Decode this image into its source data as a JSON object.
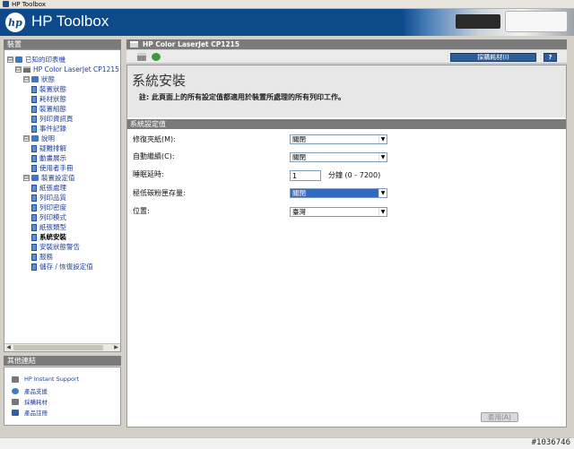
{
  "window": {
    "title": "HP Toolbox"
  },
  "banner": {
    "logo_text": "hp",
    "app_title": "HP Toolbox"
  },
  "left": {
    "device_header": "裝置",
    "tree": [
      {
        "label": "已知的印表機",
        "icon": "folder-icon",
        "expander": "⊟"
      },
      {
        "label": "HP Color LaserJet CP1215 (USB",
        "icon": "printer-icon",
        "expander": "⊟"
      },
      {
        "label": "狀態",
        "icon": "folder-icon",
        "expander": "⊟"
      },
      {
        "label": "裝置狀態",
        "icon": "page-icon"
      },
      {
        "label": "耗材狀態",
        "icon": "page-icon"
      },
      {
        "label": "裝置組態",
        "icon": "page-icon"
      },
      {
        "label": "列印資訊頁",
        "icon": "page-icon"
      },
      {
        "label": "事件記錄",
        "icon": "page-icon"
      },
      {
        "label": "說明",
        "icon": "folder-icon",
        "expander": "⊟"
      },
      {
        "label": "疑難排解",
        "icon": "page-icon"
      },
      {
        "label": "動畫展示",
        "icon": "page-icon"
      },
      {
        "label": "使用者手冊",
        "icon": "page-icon"
      },
      {
        "label": "裝置設定值",
        "icon": "folder-icon",
        "expander": "⊟"
      },
      {
        "label": "紙張處理",
        "icon": "page-icon"
      },
      {
        "label": "列印品質",
        "icon": "page-icon"
      },
      {
        "label": "列印密度",
        "icon": "page-icon"
      },
      {
        "label": "列印模式",
        "icon": "page-icon"
      },
      {
        "label": "紙張類型",
        "icon": "page-icon"
      },
      {
        "label": "系統安裝",
        "icon": "page-icon",
        "selected": true
      },
      {
        "label": "安裝狀態警告",
        "icon": "page-icon"
      },
      {
        "label": "服務",
        "icon": "page-icon"
      },
      {
        "label": "儲存 / 恢復設定值",
        "icon": "page-icon"
      }
    ],
    "links_header": "其他連結",
    "links": [
      {
        "label": "HP Instant Support",
        "icon": "printer-icon"
      },
      {
        "label": "產品支援",
        "icon": "gear-icon"
      },
      {
        "label": "採購耗材",
        "icon": "printer-icon"
      },
      {
        "label": "產品註冊",
        "icon": "registration-icon"
      }
    ]
  },
  "main": {
    "header": "HP Color LaserJet CP1215",
    "toolbar": {
      "order_supplies": "採購耗材(I)",
      "help": "?"
    },
    "title": "系統安裝",
    "note": "註:  此頁面上的所有設定值都適用於裝置所處理的所有列印工作。",
    "section": "系統設定值",
    "fields": {
      "jam_recovery": {
        "label": "修復夾紙(M):",
        "value": "關閉"
      },
      "auto_continue": {
        "label": "自動繼續(C):",
        "value": "關閉"
      },
      "sleep_delay": {
        "label": "睡眠延時:",
        "value": "1",
        "unit": "分鐘 (0 - 7200)"
      },
      "low_cartridge": {
        "label": "極低碳粉匣存量:",
        "value": "關閉"
      },
      "location": {
        "label": "位置:",
        "value": "臺灣"
      }
    },
    "apply": "套用(A)"
  },
  "watermark": "#1036746",
  "colors": {
    "banner": "#0d4a8c",
    "pane_header": "#7a7a7a",
    "selection": "#316ac5",
    "link": "#1f3f9a"
  }
}
